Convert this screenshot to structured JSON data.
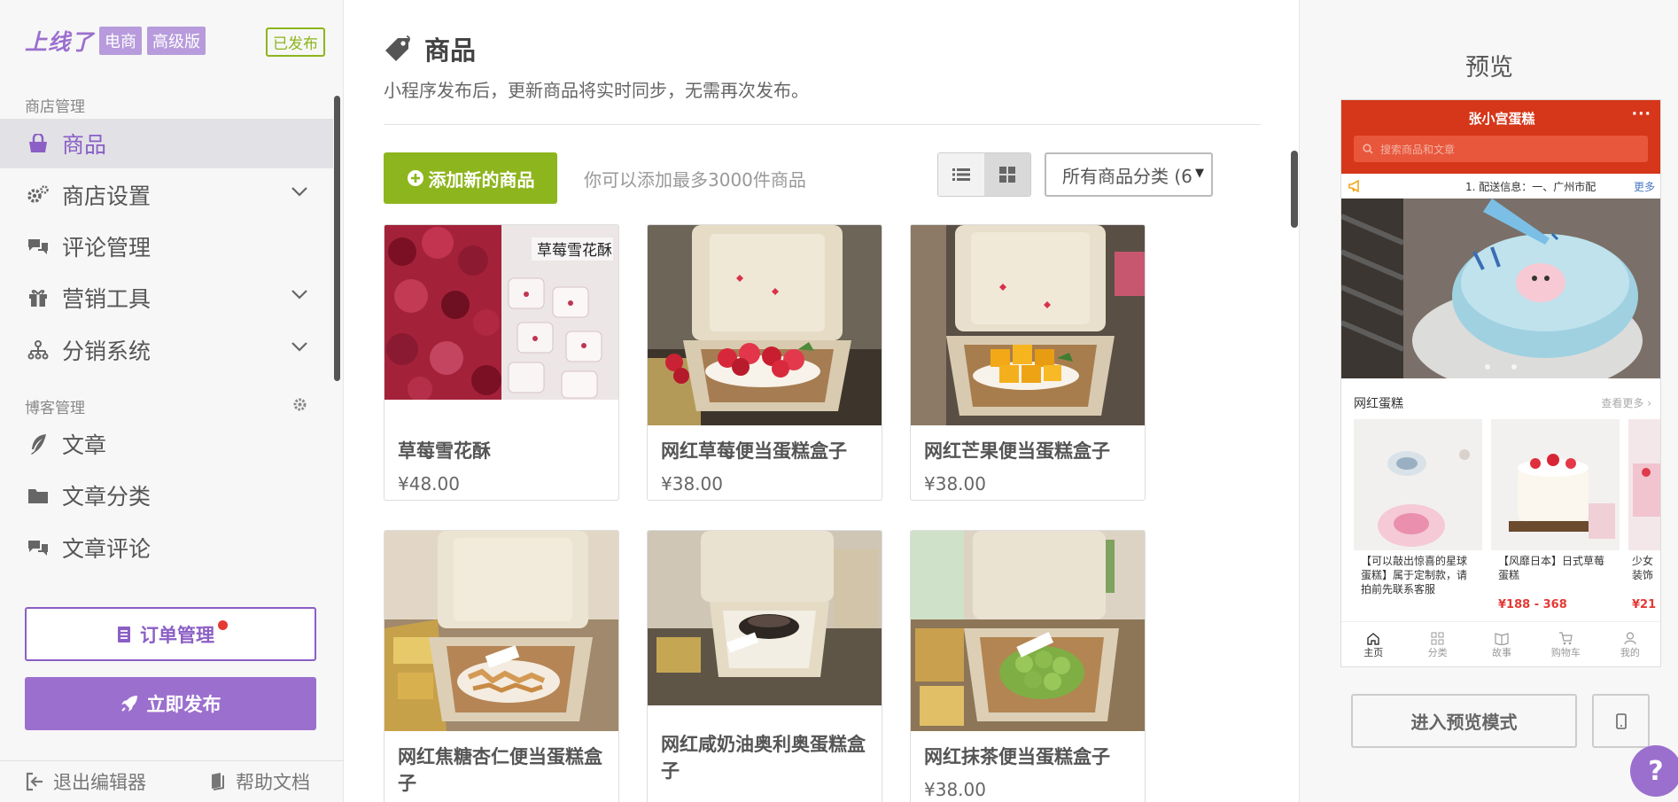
{
  "brand": {
    "logo": "上线了",
    "tag1": "电商",
    "tag2": "高级版",
    "status": "已发布"
  },
  "sidebar": {
    "section_store": "商店管理",
    "items": [
      {
        "label": "商品",
        "icon": "shopping-bag-icon",
        "active": true
      },
      {
        "label": "商店设置",
        "icon": "gears-icon",
        "has_chevron": true
      },
      {
        "label": "评论管理",
        "icon": "comments-icon"
      },
      {
        "label": "营销工具",
        "icon": "gift-icon",
        "has_chevron": true
      },
      {
        "label": "分销系统",
        "icon": "sitemap-icon",
        "has_chevron": true
      }
    ],
    "section_blog": "博客管理",
    "blog_items": [
      {
        "label": "文章",
        "icon": "feather-icon"
      },
      {
        "label": "文章分类",
        "icon": "folder-icon"
      },
      {
        "label": "文章评论",
        "icon": "comments-icon"
      }
    ],
    "orders_button": "订单管理",
    "publish_button": "立即发布",
    "footer": {
      "exit": "退出编辑器",
      "help": "帮助文档"
    }
  },
  "main": {
    "title": "商品",
    "description": "小程序发布后，更新商品将实时同步，无需再次发布。",
    "add_button": "添加新的商品",
    "add_hint": "你可以添加最多3000件商品",
    "category_select": "所有商品分类 (6",
    "products": [
      {
        "name": "草莓雪花酥",
        "price": "¥48.00",
        "image_label": "草莓雪花酥"
      },
      {
        "name": "网红草莓便当蛋糕盒子",
        "price": "¥38.00"
      },
      {
        "name": "网红芒果便当蛋糕盒子",
        "price": "¥38.00"
      },
      {
        "name": "网红焦糖杏仁便当蛋糕盒子",
        "price": ""
      },
      {
        "name": "网红咸奶油奥利奥蛋糕盒子",
        "price": ""
      },
      {
        "name": "网红抹茶便当蛋糕盒子",
        "price": "¥38.00"
      }
    ]
  },
  "preview": {
    "title": "预览",
    "shop_name": "张小宫蛋糕",
    "more": "···",
    "search_placeholder": "搜索商品和文章",
    "notice": "1. 配送信息：一、广州市配",
    "notice_more": "更多",
    "section_title": "网红蛋糕",
    "see_more": "查看更多",
    "products": [
      {
        "name": "【可以敲出惊喜的星球蛋糕】属于定制款，请拍前先联系客服",
        "price": ""
      },
      {
        "name": "【风靡日本】日式草莓蛋糕",
        "price": "¥188 - 368"
      },
      {
        "name": "少女装饰",
        "price": "¥21"
      }
    ],
    "tabs": [
      "主页",
      "分类",
      "故事",
      "购物车",
      "我的"
    ],
    "preview_mode_button": "进入预览模式"
  },
  "help": "?"
}
